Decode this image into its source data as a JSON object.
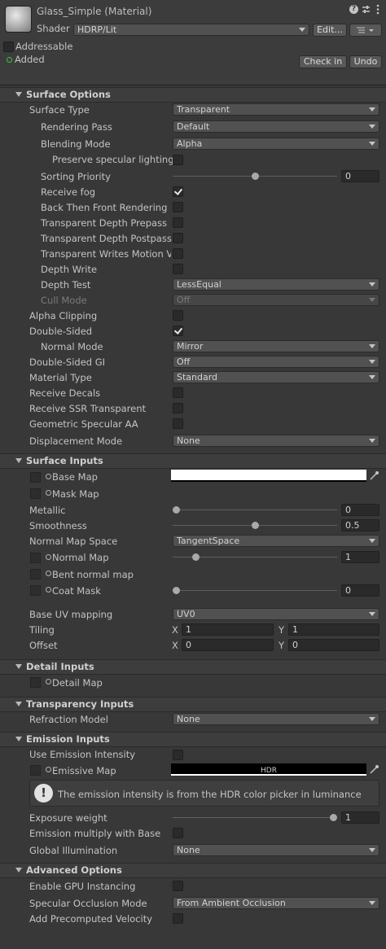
{
  "header": {
    "title": "Glass_Simple (Material)",
    "shader_label": "Shader",
    "shader_value": "HDRP/Lit",
    "edit_button": "Edit...",
    "addressable_label": "Addressable",
    "added_label": "Added",
    "checkin_button": "Check in",
    "undo_button": "Undo",
    "icons": [
      "help-icon",
      "presets-icon",
      "more-icon",
      "list-icon"
    ]
  },
  "surface_options": {
    "title": "Surface Options",
    "surface_type": {
      "label": "Surface Type",
      "value": "Transparent"
    },
    "rendering_pass": {
      "label": "Rendering Pass",
      "value": "Default"
    },
    "blending_mode": {
      "label": "Blending Mode",
      "value": "Alpha"
    },
    "preserve_specular": {
      "label": "Preserve specular lighting",
      "checked": false
    },
    "sorting_priority": {
      "label": "Sorting Priority",
      "value": "0",
      "fraction": 0.5
    },
    "receive_fog": {
      "label": "Receive fog",
      "checked": true
    },
    "back_then_front": {
      "label": "Back Then Front Rendering",
      "checked": false
    },
    "depth_prepass": {
      "label": "Transparent Depth Prepass",
      "checked": false
    },
    "depth_postpass": {
      "label": "Transparent Depth Postpass",
      "checked": false
    },
    "motion_vectors": {
      "label": "Transparent Writes Motion Vec",
      "checked": false
    },
    "depth_write": {
      "label": "Depth Write",
      "checked": false
    },
    "depth_test": {
      "label": "Depth Test",
      "value": "LessEqual"
    },
    "cull_mode": {
      "label": "Cull Mode",
      "value": "Off"
    },
    "alpha_clipping": {
      "label": "Alpha Clipping",
      "checked": false
    },
    "double_sided": {
      "label": "Double-Sided",
      "checked": true
    },
    "normal_mode": {
      "label": "Normal Mode",
      "value": "Mirror"
    },
    "double_sided_gi": {
      "label": "Double-Sided GI",
      "value": "Off"
    },
    "material_type": {
      "label": "Material Type",
      "value": "Standard"
    },
    "receive_decals": {
      "label": "Receive Decals",
      "checked": false
    },
    "receive_ssr": {
      "label": "Receive SSR Transparent",
      "checked": false
    },
    "geometric_aa": {
      "label": "Geometric Specular AA",
      "checked": false
    },
    "displacement_mode": {
      "label": "Displacement Mode",
      "value": "None"
    }
  },
  "surface_inputs": {
    "title": "Surface Inputs",
    "base_map": {
      "label": "Base Map",
      "color": "#ffffff"
    },
    "mask_map": {
      "label": "Mask Map"
    },
    "metallic": {
      "label": "Metallic",
      "value": "0",
      "fraction": 0.0
    },
    "smoothness": {
      "label": "Smoothness",
      "value": "0.5",
      "fraction": 0.5
    },
    "normal_map_space": {
      "label": "Normal Map Space",
      "value": "TangentSpace"
    },
    "normal_map": {
      "label": "Normal Map",
      "value": "1",
      "fraction": 0.125
    },
    "bent_normal": {
      "label": "Bent normal map"
    },
    "coat_mask": {
      "label": "Coat Mask",
      "value": "0",
      "fraction": 0.0
    },
    "base_uv": {
      "label": "Base UV mapping",
      "value": "UV0"
    },
    "tiling": {
      "label": "Tiling",
      "x_label": "X",
      "x": "1",
      "y_label": "Y",
      "y": "1"
    },
    "offset": {
      "label": "Offset",
      "x_label": "X",
      "x": "0",
      "y_label": "Y",
      "y": "0"
    }
  },
  "detail_inputs": {
    "title": "Detail Inputs",
    "detail_map": {
      "label": "Detail Map"
    }
  },
  "transparency_inputs": {
    "title": "Transparency Inputs",
    "refraction_model": {
      "label": "Refraction Model",
      "value": "None"
    }
  },
  "emission_inputs": {
    "title": "Emission Inputs",
    "use_intensity": {
      "label": "Use Emission Intensity",
      "checked": false
    },
    "emissive_map": {
      "label": "Emissive Map",
      "hdr_tag": "HDR",
      "color": "#000000"
    },
    "info": "The emission intensity is from the HDR color picker in luminance",
    "exposure_weight": {
      "label": "Exposure weight",
      "value": "1",
      "fraction": 1.0
    },
    "multiply_base": {
      "label": "Emission multiply with Base",
      "checked": false
    },
    "global_illumination": {
      "label": "Global Illumination",
      "value": "None"
    }
  },
  "advanced_options": {
    "title": "Advanced Options",
    "gpu_instancing": {
      "label": "Enable GPU Instancing",
      "checked": false
    },
    "specular_occlusion": {
      "label": "Specular Occlusion Mode",
      "value": "From Ambient Occlusion"
    },
    "precomputed_velocity": {
      "label": "Add Precomputed Velocity",
      "checked": false
    }
  },
  "colors": {
    "background": "#383838",
    "section": "#3d3d3d",
    "field": "#2a2a2a",
    "dropdown": "#515151",
    "added_dot": "#3fbf3f"
  }
}
